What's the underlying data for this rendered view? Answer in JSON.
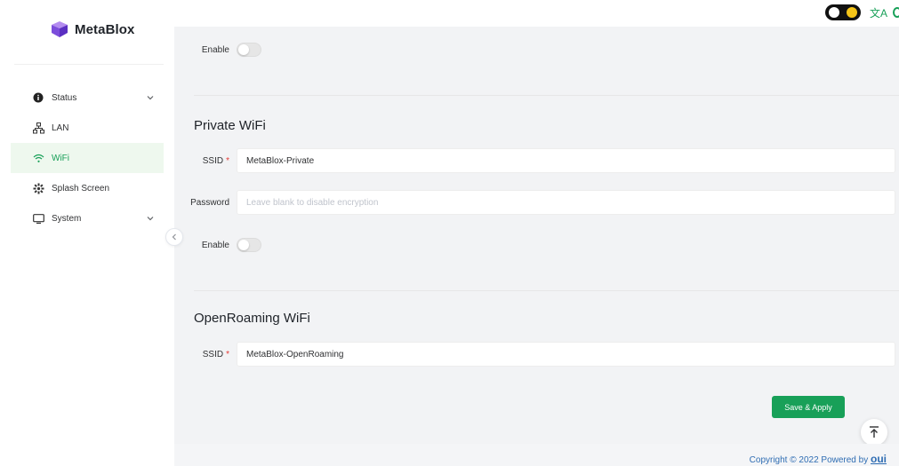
{
  "sidebar": {
    "logo_text": "MetaBlox",
    "items": [
      {
        "label": "Status",
        "icon": "info-circle-icon",
        "has_chevron": true
      },
      {
        "label": "LAN",
        "icon": "network-icon",
        "has_chevron": false
      },
      {
        "label": "WiFi",
        "icon": "wifi-icon",
        "has_chevron": false,
        "active": true
      },
      {
        "label": "Splash Screen",
        "icon": "splash-icon",
        "has_chevron": false
      },
      {
        "label": "System",
        "icon": "monitor-icon",
        "has_chevron": true
      }
    ]
  },
  "header": {
    "translate_glyph": "文A"
  },
  "form": {
    "enable_label_1": "Enable",
    "private_title": "Private WiFi",
    "private_ssid_label": "SSID",
    "private_ssid_value": "MetaBlox-Private",
    "password_label": "Password",
    "password_placeholder": "Leave blank to disable encryption",
    "enable_label_2": "Enable",
    "openroaming_title": "OpenRoaming WiFi",
    "openroaming_ssid_label": "SSID",
    "openroaming_ssid_value": "MetaBlox-OpenRoaming",
    "required_mark": "*",
    "save_label": "Save & Apply"
  },
  "footer": {
    "copyright": "Copyright © 2022 Powered by ",
    "brand": "oui"
  },
  "colors": {
    "accent": "#18a058",
    "active_bg": "#eef8ee",
    "link": "#2f6db3"
  }
}
